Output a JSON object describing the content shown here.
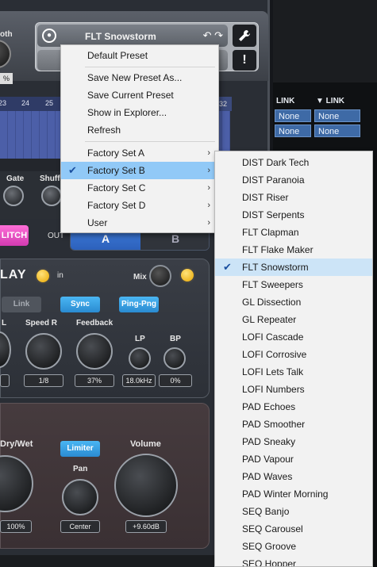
{
  "header": {
    "synth_label": "oth",
    "synth_small": "%",
    "preset_name": "FLT Snowstorm",
    "undo_redo": "↶ ↷",
    "tool_icon": "wrench-icon",
    "alert_label": "!"
  },
  "ruler": {
    "ticks": [
      "23",
      "24",
      "25"
    ],
    "end_tick": "32"
  },
  "knobs_top": {
    "gate_label": "Gate",
    "shuffle_label": "Shuff"
  },
  "routing": {
    "glitch_label": "LITCH",
    "out_label": "OUT",
    "tab_a": "A",
    "tab_b": "B"
  },
  "delay": {
    "title": "LAY",
    "in_label": "in",
    "mix_label": "Mix",
    "link_label": "Link",
    "sync_label": "Sync",
    "pingpong_label": "Ping-Png",
    "l_label": "L",
    "speed_r_label": "Speed R",
    "feedback_label": "Feedback",
    "lp_label": "LP",
    "bp_label": "BP",
    "speed_r_value": "1/8",
    "feedback_value": "37%",
    "lp_value": "18.0kHz",
    "bp_value": "0%"
  },
  "output": {
    "drywet_label": "Dry/Wet",
    "limiter_label": "Limiter",
    "volume_label": "Volume",
    "pan_label": "Pan",
    "drywet_value": "100%",
    "pan_value": "Center",
    "volume_value": "+9.60dB"
  },
  "daw": {
    "link_headers": [
      "LINK",
      "▼ LINK"
    ],
    "none_values": [
      "None",
      "None",
      "None",
      "None"
    ]
  },
  "menu": {
    "items": [
      {
        "label": "Default Preset"
      },
      {
        "label": "Save New Preset As..."
      },
      {
        "label": "Save Current Preset"
      },
      {
        "label": "Show in Explorer..."
      },
      {
        "label": "Refresh"
      },
      {
        "label": "Factory Set A"
      },
      {
        "label": "Factory Set B"
      },
      {
        "label": "Factory Set C"
      },
      {
        "label": "Factory Set D"
      },
      {
        "label": "User"
      }
    ]
  },
  "submenu": {
    "selected": "FLT Snowstorm",
    "items": [
      "DIST Dark Tech",
      "DIST Paranoia",
      "DIST Riser",
      "DIST Serpents",
      "FLT Clapman",
      "FLT Flake Maker",
      "FLT Snowstorm",
      "FLT Sweepers",
      "GL Dissection",
      "GL Repeater",
      "LOFI Cascade",
      "LOFI Corrosive",
      "LOFI Lets Talk",
      "LOFI Numbers",
      "PAD Echoes",
      "PAD Smoother",
      "PAD Sneaky",
      "PAD Vapour",
      "PAD Waves",
      "PAD Winter Morning",
      "SEQ Banjo",
      "SEQ Carousel",
      "SEQ Groove",
      "SEQ Hopper"
    ]
  },
  "colors": {
    "menu_highlight": "#91c9f7",
    "submenu_highlight": "#cce4f7",
    "accent_blue": "#3f7cdb",
    "led_yellow": "#f5c400"
  }
}
